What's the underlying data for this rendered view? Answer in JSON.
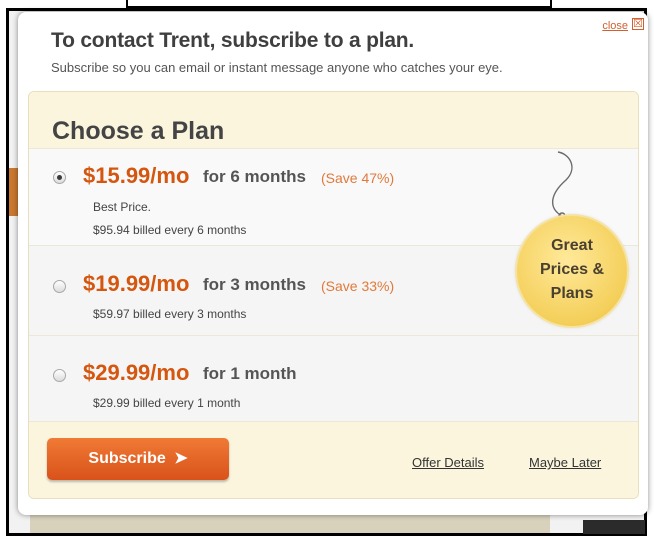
{
  "dialog": {
    "close_label": "close",
    "close_icon": "☒",
    "title": "To contact Trent, subscribe to a plan.",
    "subtitle": "Subscribe so you can email or instant message anyone who catches your eye."
  },
  "panel": {
    "title": "Choose a Plan",
    "plans": [
      {
        "price": "$15.99/mo",
        "period": "for 6 months",
        "save": "(Save 47%)",
        "badge": "Best Price.",
        "billing": "$95.94 billed every 6 months",
        "selected": true
      },
      {
        "price": "$19.99/mo",
        "period": "for 3 months",
        "save": "(Save 33%)",
        "billing": "$59.97 billed every 3 months",
        "selected": false
      },
      {
        "price": "$29.99/mo",
        "period": "for 1 month",
        "billing": "$29.99 billed every 1 month",
        "selected": false
      }
    ],
    "seal": {
      "line1": "Great",
      "line2": "Prices &",
      "line3": "Plans"
    }
  },
  "footer": {
    "subscribe_label": "Subscribe",
    "subscribe_arrow": "➤",
    "offer_details": "Offer Details",
    "maybe_later": "Maybe Later"
  },
  "colors": {
    "accent": "#d4560f",
    "save": "#e07a3c",
    "panel_bg": "#fbf5de",
    "seal": "#f4cf5a"
  }
}
